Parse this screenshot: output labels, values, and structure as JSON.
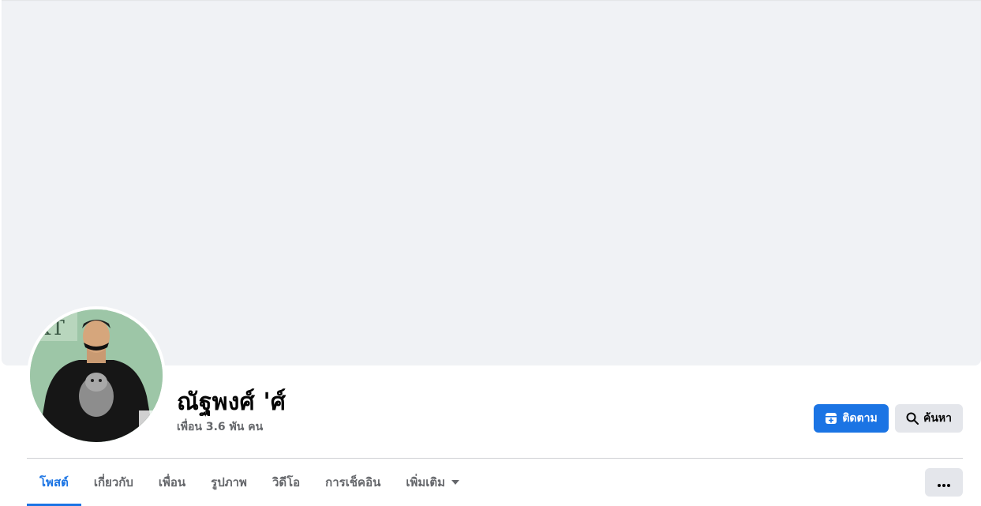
{
  "profile": {
    "name": "ณัฐพงศ์ 'ศ์",
    "friends_count": "เพื่อน 3.6 พัน คน"
  },
  "actions": {
    "follow_label": "ติดตาม",
    "search_label": "ค้นหา"
  },
  "tabs": [
    {
      "label": "โพสต์",
      "active": true
    },
    {
      "label": "เกี่ยวกับ",
      "active": false
    },
    {
      "label": "เพื่อน",
      "active": false
    },
    {
      "label": "รูปภาพ",
      "active": false
    },
    {
      "label": "วิดีโอ",
      "active": false
    },
    {
      "label": "การเช็คอิน",
      "active": false
    },
    {
      "label": "เพิ่มเติม",
      "active": false
    }
  ],
  "icons": {
    "follow": "follow-icon",
    "search": "search-icon",
    "more_tabs": "caret-down-icon",
    "more_options": "ellipsis-icon"
  },
  "colors": {
    "accent": "#1b74e4",
    "cover_background": "#f0f2f5",
    "secondary_button": "#e4e6eb",
    "secondary_text": "#65676b"
  }
}
